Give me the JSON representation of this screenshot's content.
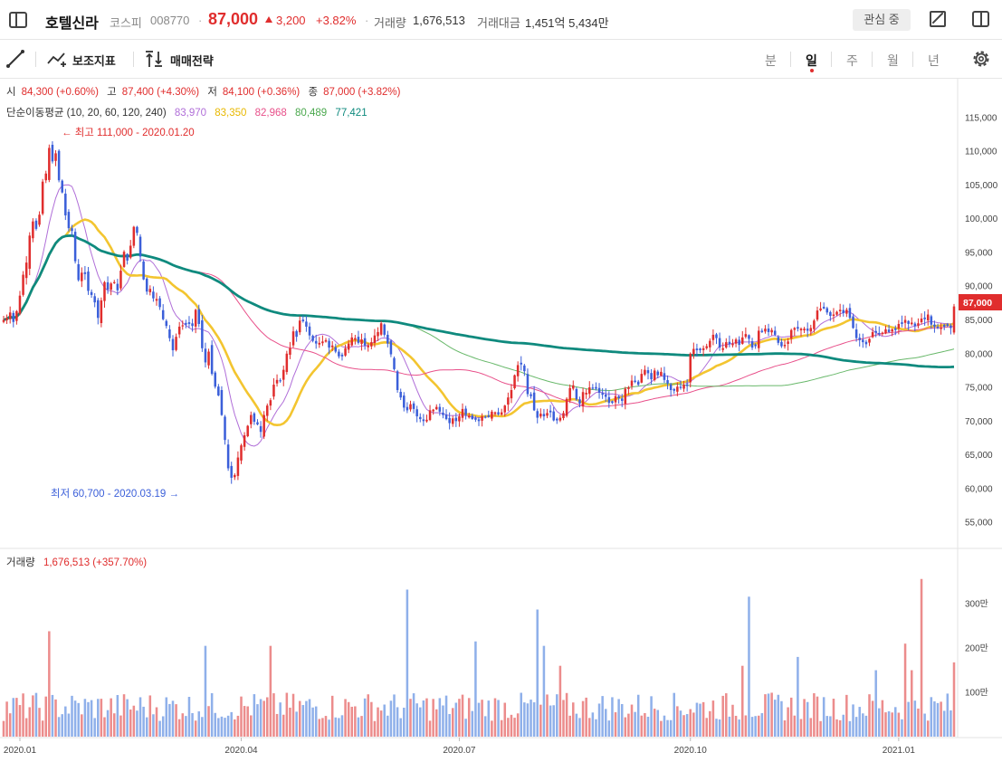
{
  "header": {
    "stock_name": "호텔신라",
    "market": "코스피",
    "code": "008770",
    "price": "87,000",
    "change_value": "3,200",
    "change_pct": "+3.82%",
    "volume_label": "거래량",
    "volume_value": "1,676,513",
    "amount_label": "거래대금",
    "amount_value": "1,451억 5,434만",
    "watch_label": "관심 중"
  },
  "toolbar": {
    "indicator_label": "보조지표",
    "strategy_label": "매매전략",
    "periods": [
      "분",
      "일",
      "주",
      "월",
      "년"
    ],
    "active_period": "일"
  },
  "ohlc_line": {
    "open_label": "시",
    "open": "84,300 (+0.60%)",
    "high_label": "고",
    "high": "87,400 (+4.30%)",
    "low_label": "저",
    "low": "84,100 (+0.36%)",
    "close_label": "종",
    "close": "87,000 (+3.82%)"
  },
  "ma_line": {
    "label": "단순이동평균 (10, 20, 60, 120, 240)",
    "values": [
      "83,970",
      "83,350",
      "82,968",
      "80,489",
      "77,421"
    ],
    "colors": [
      "#b06ed8",
      "#f3c530",
      "#e8508a",
      "#68b86a",
      "#0f8a7e"
    ]
  },
  "annotations": {
    "high": "최고 111,000 - 2020.01.20",
    "low": "최저 60,700 - 2020.03.19"
  },
  "volume_panel": {
    "label": "거래량",
    "value": "1,676,513 (+357.70%)"
  },
  "colors": {
    "up": "#e02d2d",
    "down": "#3b5fd9",
    "vol_up": "#ec8c8c",
    "vol_down": "#8fb0ea",
    "current_price_bg": "#e02d2d"
  },
  "chart_data": {
    "type": "candlestick",
    "y_ticks": [
      "115,000",
      "110,000",
      "105,000",
      "100,000",
      "95,000",
      "90,000",
      "85,000",
      "80,000",
      "75,000",
      "70,000",
      "65,000",
      "60,000",
      "55,000"
    ],
    "y_tick_values": [
      115000,
      110000,
      105000,
      100000,
      95000,
      90000,
      85000,
      80000,
      75000,
      70000,
      65000,
      60000,
      55000
    ],
    "ylim": [
      53000,
      117000
    ],
    "current_price_label": "87,000",
    "current_price": 87000,
    "x_ticks": [
      "2020.01",
      "2020.04",
      "2020.07",
      "2020.10",
      "2021.01"
    ],
    "x_tick_index": [
      5,
      73,
      140,
      211,
      275
    ],
    "volume_ticks": [
      "300만",
      "200만",
      "100만"
    ],
    "volume_tick_values": [
      3000000,
      2000000,
      1000000
    ],
    "volume_max": 3800000,
    "closes": [
      85000,
      85300,
      86100,
      84700,
      86300,
      88600,
      91700,
      93500,
      97500,
      99600,
      98500,
      100600,
      105500,
      106700,
      110500,
      108500,
      109700,
      105700,
      103900,
      100500,
      98600,
      98200,
      93700,
      90900,
      92000,
      91800,
      89300,
      88700,
      87600,
      85300,
      87900,
      90600,
      89500,
      90400,
      90600,
      89400,
      92300,
      95100,
      93800,
      96000,
      98800,
      97900,
      94400,
      91000,
      89200,
      89600,
      88200,
      88100,
      86900,
      85100,
      84100,
      82300,
      80500,
      82500,
      84000,
      84200,
      84300,
      84400,
      84100,
      86500,
      84400,
      80800,
      78700,
      80300,
      77000,
      75100,
      73800,
      70900,
      67200,
      63000,
      61600,
      62000,
      64600,
      66400,
      67900,
      69300,
      70900,
      69900,
      69500,
      68400,
      70900,
      72300,
      73100,
      75400,
      76100,
      75900,
      77600,
      80000,
      80800,
      83300,
      82500,
      84900,
      84800,
      84000,
      82700,
      81900,
      81500,
      81600,
      81800,
      82000,
      80900,
      81200,
      80300,
      79600,
      79600,
      80800,
      81500,
      82400,
      82300,
      81600,
      82100,
      81200,
      81200,
      81700,
      82700,
      83200,
      84500,
      82800,
      81500,
      79900,
      77700,
      74600,
      73500,
      72000,
      71600,
      72500,
      71800,
      70700,
      70300,
      70000,
      70200,
      71600,
      71700,
      72100,
      71400,
      70900,
      70300,
      69700,
      70400,
      70000,
      70700,
      71800,
      70900,
      70800,
      70300,
      70200,
      70000,
      70700,
      70500,
      70600,
      71400,
      71300,
      71000,
      71300,
      72300,
      73500,
      74600,
      76800,
      78300,
      78400,
      77400,
      74000,
      73700,
      71600,
      70500,
      71100,
      70700,
      71200,
      71300,
      70100,
      70100,
      70500,
      71200,
      73300,
      74900,
      75300,
      73200,
      72600,
      74300,
      74200,
      75000,
      74800,
      74800,
      74200,
      73900,
      73600,
      72700,
      72700,
      73700,
      73400,
      73000,
      74800,
      75000,
      76000,
      75800,
      75400,
      77000,
      77600,
      77100,
      76200,
      77500,
      76800,
      77300,
      76100,
      75600,
      74600,
      74500,
      75100,
      74900,
      75400,
      75200,
      80000,
      80700,
      80500,
      80500,
      80800,
      81100,
      81900,
      82800,
      82300,
      80900,
      80800,
      81700,
      81400,
      81500,
      82100,
      81300,
      82400,
      82900,
      82200,
      80900,
      81100,
      83400,
      83200,
      83700,
      83200,
      83500,
      82800,
      81600,
      81100,
      81300,
      81800,
      83500,
      83800,
      83700,
      83700,
      83700,
      83400,
      83800,
      84900,
      86400,
      86700,
      86700,
      86100,
      85600,
      85800,
      86200,
      86500,
      86000,
      86500,
      85300,
      83800,
      82300,
      82000,
      81700,
      81400,
      82200,
      83200,
      83100,
      82900,
      83100,
      83600,
      83200,
      83600,
      83500,
      84400,
      84400,
      85000,
      84400,
      84600,
      84100,
      84500,
      85200,
      85100,
      85800,
      84300,
      84000,
      83800,
      83900,
      84000,
      84100,
      83800,
      87000
    ],
    "ma_periods": [
      10,
      20,
      60,
      120,
      240
    ]
  }
}
